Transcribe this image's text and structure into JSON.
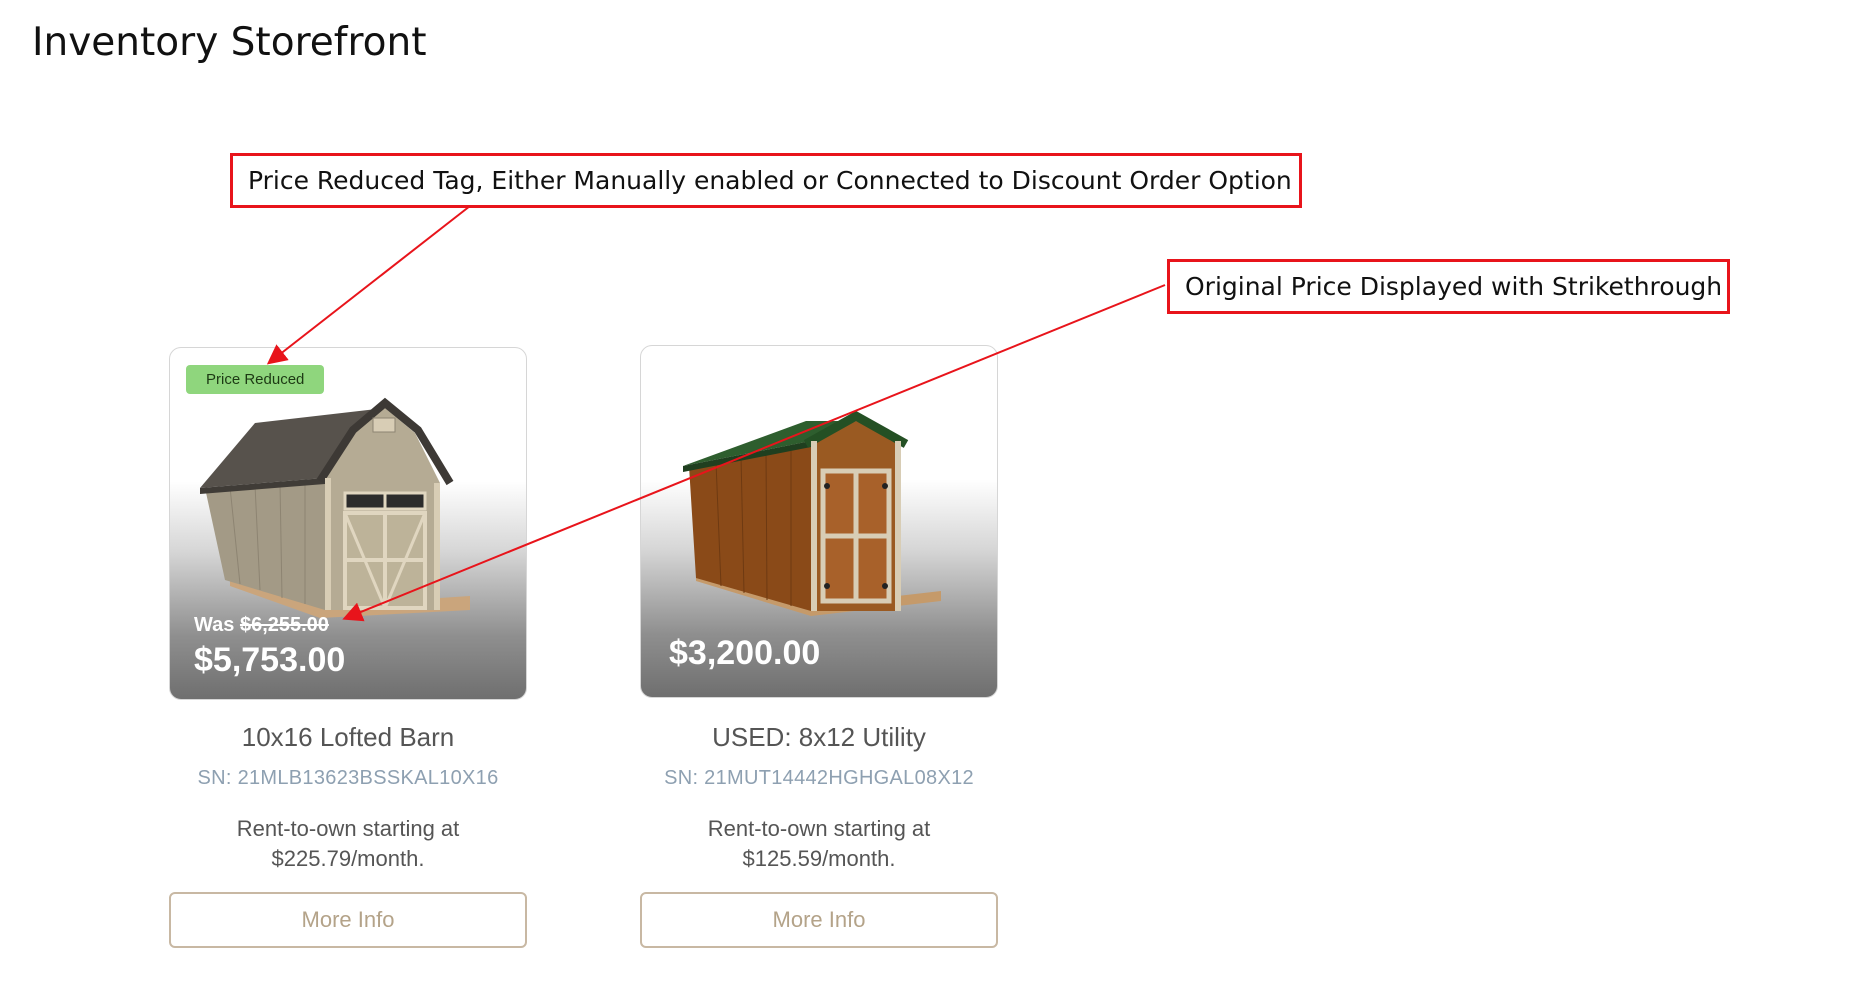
{
  "page": {
    "title": "Inventory Storefront"
  },
  "callouts": {
    "price_reduced": "Price Reduced Tag, Either Manually enabled or Connected to Discount Order Option",
    "original_price": "Original Price Displayed with Strikethrough"
  },
  "products": [
    {
      "tag": "Price Reduced",
      "was_prefix": "Was",
      "was_price": "$6,255.00",
      "price": "$5,753.00",
      "name": "10x16 Lofted Barn",
      "serial": "SN: 21MLB13623BSSKAL10X16",
      "rto_line1": "Rent-to-own starting at",
      "rto_line2": "$225.79/month.",
      "button_label": "More Info"
    },
    {
      "price": "$3,200.00",
      "name": "USED: 8x12 Utility",
      "serial": "SN: 21MUT14442HGHGAL08X12",
      "rto_line1": "Rent-to-own starting at",
      "rto_line2": "$125.59/month.",
      "button_label": "More Info"
    }
  ],
  "colors": {
    "annotation": "#e8141b",
    "tag_background": "#8fd67d",
    "button_border": "#c8b8a3",
    "serial_text": "#8ea0b1"
  },
  "icons": [
    "lofted-barn-shed-image",
    "utility-shed-image"
  ]
}
